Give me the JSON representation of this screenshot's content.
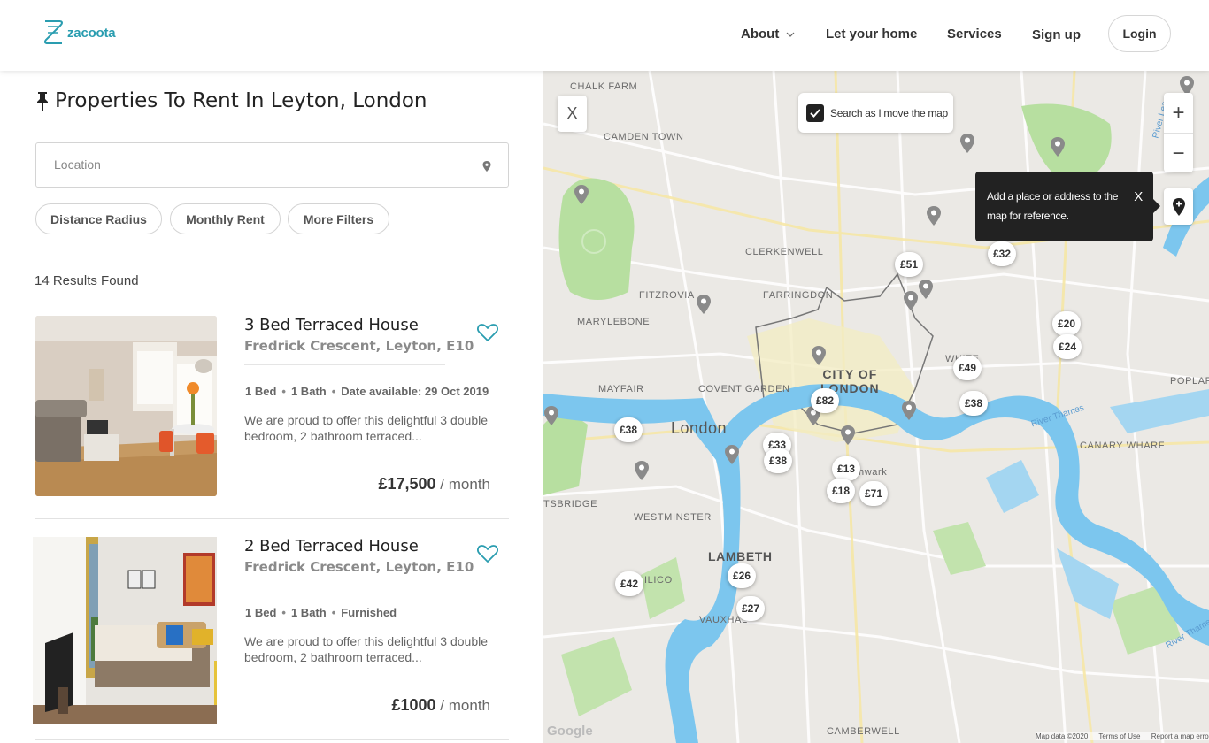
{
  "header": {
    "logo_text": "zacoota",
    "nav": {
      "about": "About",
      "let_your_home": "Let your home",
      "services": "Services",
      "sign_up": "Sign up",
      "login": "Login"
    }
  },
  "search": {
    "title": "Properties To Rent In Leyton, London",
    "location_placeholder": "Location",
    "filters": [
      "Distance Radius",
      "Monthly Rent",
      "More Filters"
    ],
    "results_text": "14 Results Found"
  },
  "listings": [
    {
      "title": "3 Bed Terraced House",
      "address": "Fredrick Crescent, Leyton, E10",
      "beds": "1 Bed",
      "baths": "1 Bath",
      "extra": "Date available: 29 Oct 2019",
      "description": "We are proud to offer this delightful 3 double bedroom, 2 bathroom terraced...",
      "price": "£17,500",
      "period": "/ month"
    },
    {
      "title": "2 Bed Terraced House",
      "address": "Fredrick Crescent, Leyton, E10",
      "beds": "1 Bed",
      "baths": "1 Bath",
      "extra": "Furnished",
      "description": "We are proud to offer this delightful 3 double bedroom, 2 bathroom terraced...",
      "price": "£1000",
      "period": "/ month"
    }
  ],
  "map": {
    "close_label": "X",
    "search_as_move": "Search as I move the map",
    "zoom_in": "+",
    "zoom_out": "−",
    "tooltip_text": "Add a place or address to the map for reference.",
    "tooltip_close": "X",
    "labels": {
      "chalk_farm": "CHALK FARM",
      "camden_town": "CAMDEN TOWN",
      "clerkenwell": "CLERKENWELL",
      "fitzrovia": "FITZROVIA",
      "farringdon": "FARRINGDON",
      "marylebone": "MARYLEBONE",
      "whitechapel": "WHITE",
      "poplar": "POPLAR",
      "city_of": "CITY OF",
      "london_city": "LONDON",
      "mayfair": "MAYFAIR",
      "covent_garden": "COVENT GARDEN",
      "london": "London",
      "canary_wharf": "CANARY WHARF",
      "knightsbridge": "TSBRIDGE",
      "westminster": "WESTMINSTER",
      "southwark": "hwark",
      "lambeth": "LAMBETH",
      "elico": "ILICO",
      "vauxhall": "VAUXHAL",
      "camberwell": "CAMBERWELL",
      "river_thames": "River Thames",
      "river_thames_2": "River Thames",
      "river_lea": "River Lea"
    },
    "price_pins": [
      "£51",
      "£32",
      "£20",
      "£24",
      "£49",
      "£38",
      "£82",
      "£38",
      "£33",
      "£38",
      "£13",
      "£18",
      "£71",
      "£42",
      "£26",
      "£27"
    ],
    "google": "Google",
    "attribution": [
      "Map data ©2020",
      "Terms of Use",
      "Report a map error"
    ]
  }
}
